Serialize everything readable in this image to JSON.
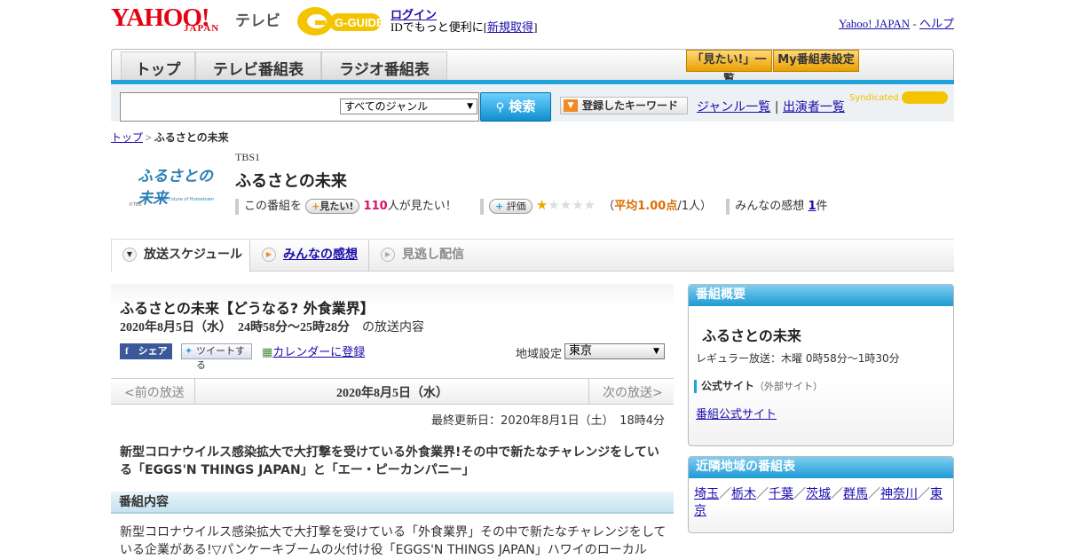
{
  "header": {
    "logo_yahoo": "YAHOO!",
    "logo_japan": "JAPAN",
    "logo_tv": "テレビ",
    "gguide_logo_text": "G-GUIDE",
    "login": "ログイン",
    "id_prefix": "IDでもっと便利に[",
    "register": "新規取得",
    "id_suffix": "]",
    "yahoo_japan_link": "Yahoo! JAPAN",
    "link_sep": " - ",
    "help_link": "ヘルプ"
  },
  "nav": {
    "tabs": [
      "トップ",
      "テレビ番組表",
      "ラジオ番組表"
    ],
    "mitai_list": "「見たい!」一覧",
    "my_settings": "My番組表設定"
  },
  "search": {
    "genre_selected": "すべてのジャンル",
    "button": "検索",
    "keyword_button": "登録したキーワード",
    "genre_list": "ジャンル一覧",
    "sep": "|",
    "performer_list": "出演者一覧",
    "syndicated": "Syndicated"
  },
  "breadcrumb": {
    "top": "トップ",
    "sep": " > ",
    "current": "ふるさとの未来"
  },
  "program": {
    "thumb_title": "ふるさとの未来",
    "thumb_sub": "The Future of Hometown",
    "thumb_credit": "©TBS",
    "channel": "TBS1",
    "title": "ふるさとの未来",
    "this_program": "この番組を",
    "mitai_btn": "見たい!",
    "mitai_count": "110",
    "mitai_suffix": "人が見たい！",
    "rating_btn": "評価",
    "rating_open": "（",
    "rating_avg": "平均1.00点",
    "rating_people": "/1人）",
    "rating_value": 1,
    "rating_max": 5,
    "impressions_label": "みんなの感想",
    "impressions_count": "1",
    "impressions_suffix": "件"
  },
  "subtabs": [
    "放送スケジュール",
    "みんなの感想",
    "見逃し配信"
  ],
  "episode": {
    "title": "ふるさとの未来【どうなる? 外食業界】",
    "datetime": "2020年8月5日（水）　24時58分～25時28分",
    "datetime_suffix": "の放送内容",
    "share_fb": "シェア",
    "share_tw": "ツイートする",
    "calendar": "カレンダーに登録",
    "region_label": "地域設定",
    "region_value": "東京",
    "prev": "<前の放送",
    "current_date": "2020年8月5日（水）",
    "next": "次の放送>",
    "updated": "最終更新日：2020年8月1日（土）　18時4分",
    "lead": "新型コロナウイルス感染拡大で大打撃を受けている外食業界!その中で新たなチャレンジをしている「EGGS'N THINGS JAPAN」と「エー・ピーカンパニー」",
    "section_title": "番組内容",
    "body": "新型コロナウイルス感染拡大で大打撃を受けている「外食業界」その中で新たなチャレンジをしている企業がある!▽パンケーキブームの火付け役「EGGS'N THINGS JAPAN」ハワイのローカル"
  },
  "sidebar": {
    "overview_title": "番組概要",
    "program_name": "ふるさとの未来",
    "regular": "レギュラー放送：木曜 0時58分～1時30分",
    "official_label": "公式サイト",
    "official_note": "（外部サイト）",
    "official_link": "番組公式サイト",
    "nearby_title": "近隣地域の番組表",
    "regions": [
      "埼玉",
      "栃木",
      "千葉",
      "茨城",
      "群馬",
      "神奈川",
      "東京"
    ],
    "region_sep": "／"
  },
  "colors": {
    "yahoo_red": "#e60012",
    "accent_blue": "#1ea3dc",
    "gguide_yellow": "#f5c400",
    "mitai_pink": "#d8116d",
    "rating_orange": "#d86f00"
  }
}
